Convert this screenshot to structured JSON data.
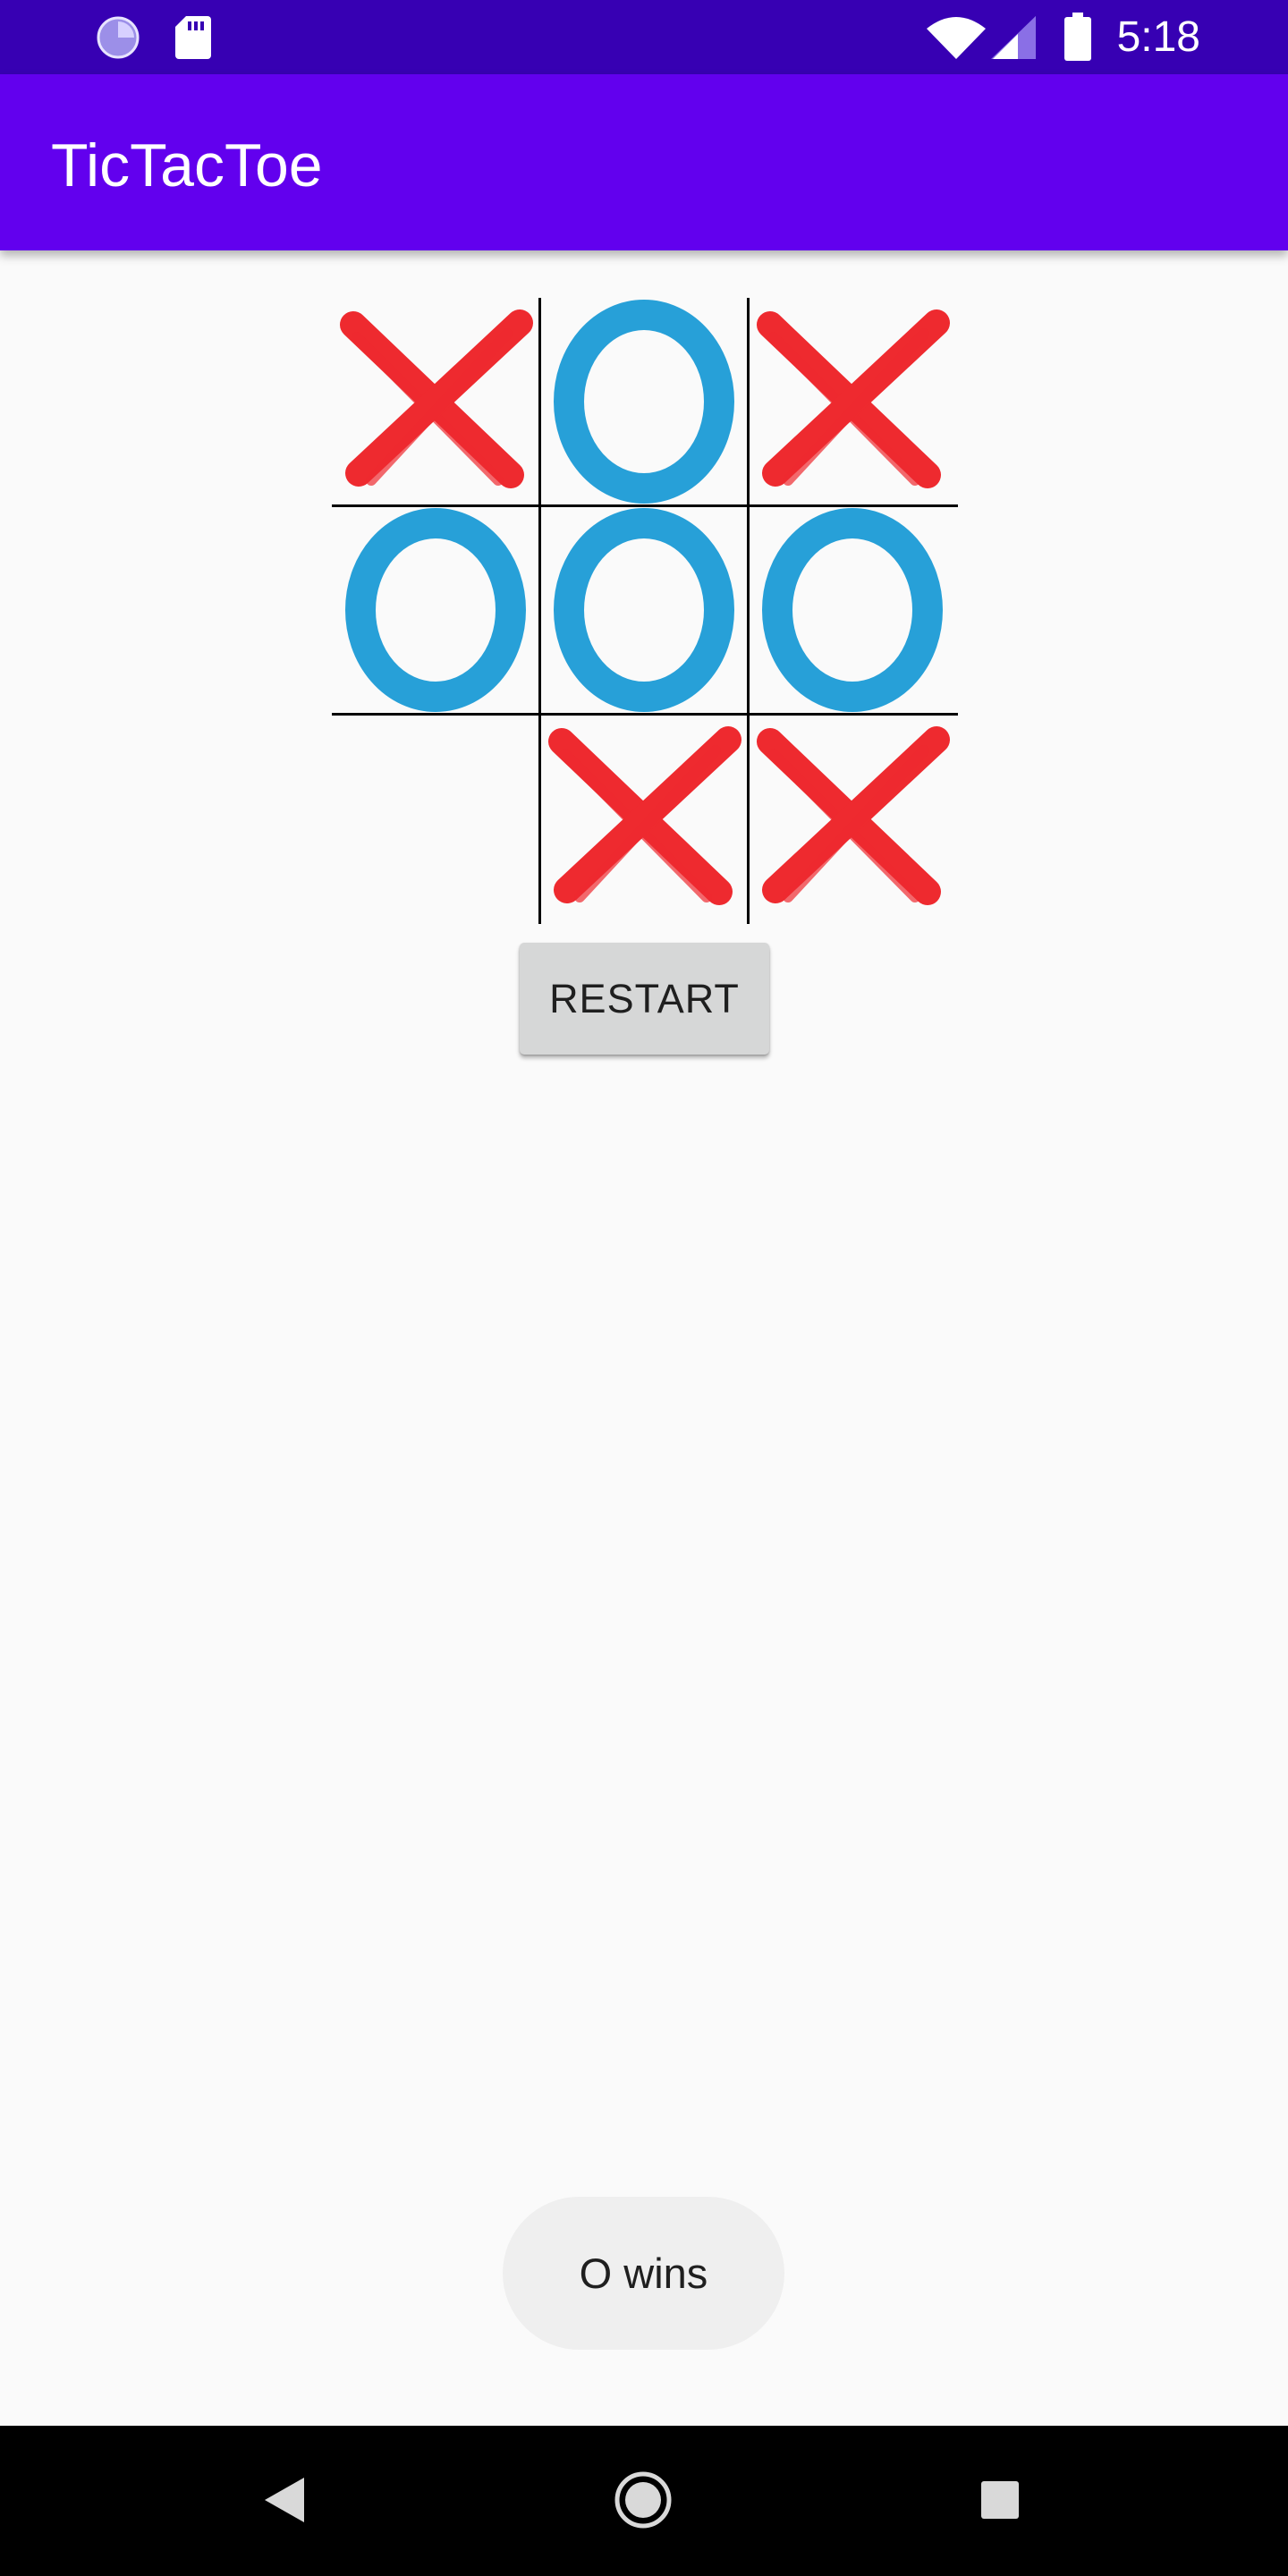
{
  "status_bar": {
    "time": "5:18",
    "left_icons": [
      "sync-icon",
      "sd-card-icon"
    ],
    "right_icons": [
      "wifi-icon",
      "signal-icon",
      "battery-icon"
    ]
  },
  "app_bar": {
    "title": "TicTacToe"
  },
  "board": {
    "cells": [
      "X",
      "O",
      "X",
      "O",
      "O",
      "O",
      "",
      "X",
      "X"
    ]
  },
  "restart_button": {
    "label": "RESTART"
  },
  "toast": {
    "message": "O wins"
  },
  "nav_bar": {
    "buttons": [
      "back-icon",
      "home-icon",
      "recents-icon"
    ]
  },
  "colors": {
    "status_bar": "#3700b3",
    "app_bar": "#6200ee",
    "x_mark": "#ee2a2f",
    "o_mark": "#27a0d8"
  }
}
